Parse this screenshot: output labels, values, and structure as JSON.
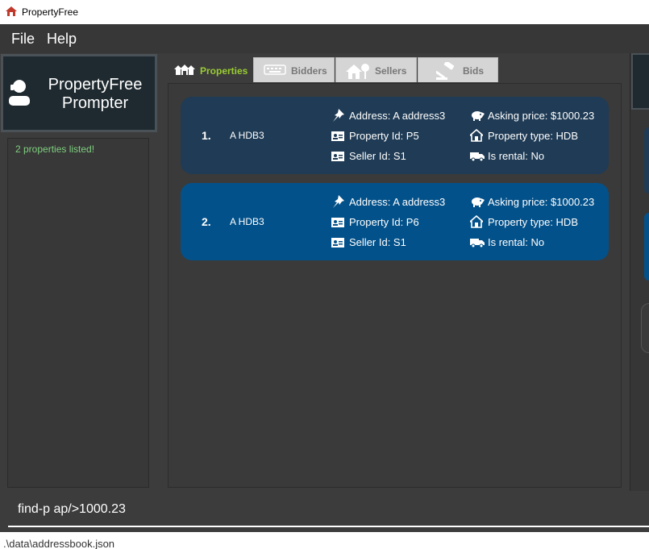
{
  "window": {
    "title": "PropertyFree"
  },
  "menu": {
    "file": "File",
    "help": "Help"
  },
  "prompter": {
    "line1": "PropertyFree",
    "line2": "Prompter"
  },
  "result": {
    "message": "2 properties listed!"
  },
  "tabs": [
    {
      "label": "Properties",
      "icon": "houses-icon",
      "active": true
    },
    {
      "label": "Bidders",
      "icon": "keyboard-icon",
      "active": false
    },
    {
      "label": "Sellers",
      "icon": "house-tree-icon",
      "active": false
    },
    {
      "label": "Bids",
      "icon": "gavel-icon",
      "active": false
    }
  ],
  "properties": [
    {
      "index": "1.",
      "name": "A HDB3",
      "address": "Address: A address3",
      "property_id": "Property Id: P5",
      "seller_id": "Seller Id: S1",
      "asking_price": "Asking price: $1000.23",
      "property_type": "Property type: HDB",
      "is_rental": "Is rental: No",
      "color": "#1f3b55"
    },
    {
      "index": "2.",
      "name": "A HDB3",
      "address": "Address: A address3",
      "property_id": "Property Id: P6",
      "seller_id": "Seller Id: S1",
      "asking_price": "Asking price: $1000.23",
      "property_type": "Property type: HDB",
      "is_rental": "Is rental: No",
      "color": "#03518a"
    }
  ],
  "command": {
    "value": "find-p ap/>1000.23"
  },
  "status": {
    "path": ".\\data\\addressbook.json"
  },
  "colors": {
    "background": "#3c3c3c",
    "active_tab": "#9acd32",
    "result_text": "#7fcf7f"
  }
}
